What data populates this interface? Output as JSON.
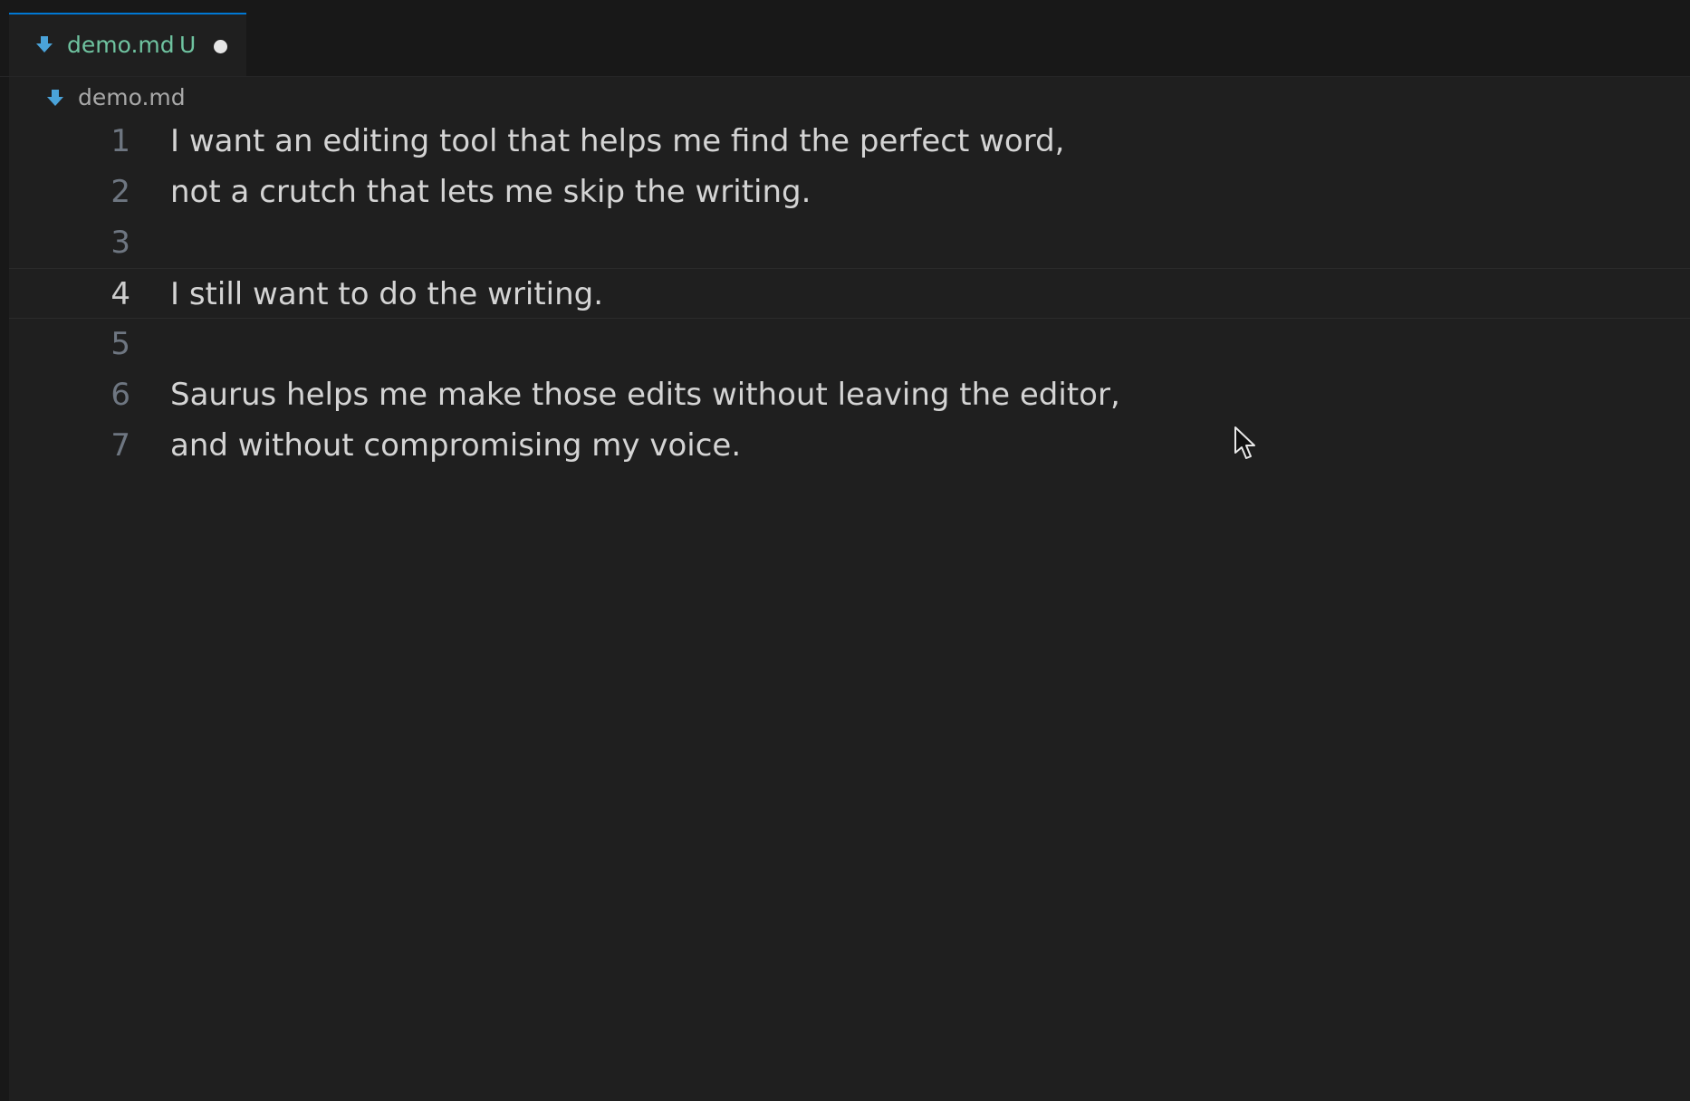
{
  "tab": {
    "filename": "demo.md",
    "git_status": "U",
    "icon": "markdown-icon",
    "unsaved": true
  },
  "breadcrumb": {
    "icon": "markdown-icon",
    "label": "demo.md"
  },
  "editor": {
    "current_line": 4,
    "lines": [
      {
        "number": "1",
        "text": "I want an editing tool that helps me find the perfect word,"
      },
      {
        "number": "2",
        "text": "not a crutch that lets me skip the writing."
      },
      {
        "number": "3",
        "text": ""
      },
      {
        "number": "4",
        "text": "I still want to do the writing."
      },
      {
        "number": "5",
        "text": ""
      },
      {
        "number": "6",
        "text": "Saurus helps me make those edits without leaving the editor,"
      },
      {
        "number": "7",
        "text": "and without compromising my voice."
      }
    ]
  },
  "colors": {
    "background": "#1f1f1f",
    "tab_active_border": "#0078d4",
    "untracked_file": "#6fc3a0",
    "markdown_icon": "#4aa3d9"
  }
}
